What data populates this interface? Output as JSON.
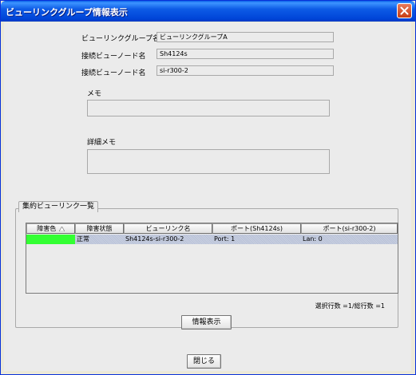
{
  "window": {
    "title": "ビューリンクグループ情報表示"
  },
  "info": {
    "group_name_label": "ビューリンクグループ名",
    "group_name_value": "ビューリンクグループA",
    "node1_label": "接続ビューノード名",
    "node1_value": "Sh4124s",
    "node2_label": "接続ビューノード名",
    "node2_value": "si-r300-2",
    "memo_label": "メモ",
    "memo_value": "",
    "detail_memo_label": "詳細メモ",
    "detail_memo_value": ""
  },
  "group": {
    "tab_label": "集約ビューリンク一覧",
    "table": {
      "columns": [
        "障害色",
        "障害状態",
        "ビューリンク名",
        "ポート(Sh4124s)",
        "ポート(si-r300-2)"
      ],
      "rows": [
        {
          "fault_color": "",
          "status": "正常",
          "link_name": "Sh4124s-si-r300-2",
          "port1": "Port: 1",
          "port2": "Lan: 0"
        }
      ]
    },
    "count_text": "選択行数 =1/総行数 =1",
    "info_button": "情報表示"
  },
  "close_button": "閉じる",
  "colors": {
    "fault_normal": "#33ff33",
    "title_bar": "#0054e3",
    "selected_row": "#c3cadc"
  }
}
